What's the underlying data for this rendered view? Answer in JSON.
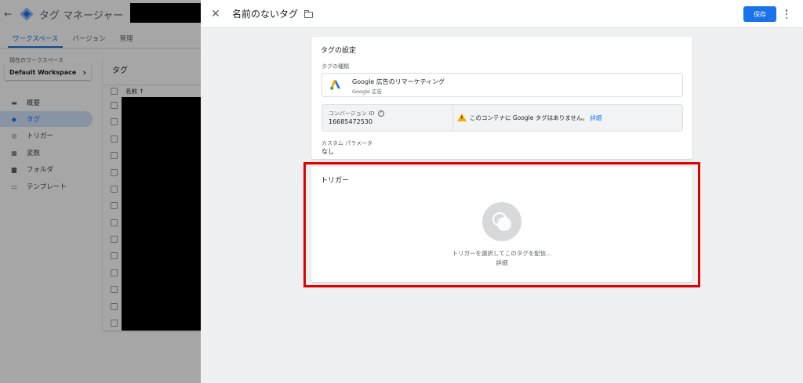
{
  "app": {
    "back_glyph": "←",
    "title": "タグ マネージャー"
  },
  "subnav": {
    "tabs": [
      "ワークスペース",
      "バージョン",
      "管理"
    ]
  },
  "workspace": {
    "label": "現在のワークスペース",
    "name": "Default Workspace",
    "chevron": "›"
  },
  "sidebar": {
    "items": [
      {
        "label": "概要",
        "icon": "overview-icon",
        "glyph": "▬"
      },
      {
        "label": "タグ",
        "icon": "tag-icon",
        "glyph": "◆"
      },
      {
        "label": "トリガー",
        "icon": "trigger-icon",
        "glyph": "◎"
      },
      {
        "label": "変数",
        "icon": "variables-icon",
        "glyph": "▦"
      },
      {
        "label": "フォルダ",
        "icon": "folder-icon",
        "glyph": "▆"
      },
      {
        "label": "テンプレート",
        "icon": "template-icon",
        "glyph": "▭"
      }
    ]
  },
  "tag_list": {
    "title": "タグ",
    "col_name": "名前 ↑"
  },
  "panel": {
    "close_glyph": "✕",
    "title": "名前のないタグ",
    "save_label": "保存",
    "config": {
      "title": "タグの設定",
      "type_label": "タグの種類",
      "type_name": "Google 広告のリマーケティング",
      "type_sub": "Google 広告",
      "conversion_label": "コンバージョン ID",
      "help_glyph": "?",
      "conversion_value": "16685472530",
      "warning_text": "このコンテナに Google タグはありません。",
      "warning_link": "詳細",
      "custom_params_label": "カスタム パラメータ",
      "custom_params_value": "なし"
    },
    "trigger": {
      "title": "トリガー",
      "empty_text": "トリガーを選択してこのタグを配信...",
      "link": "詳細"
    }
  },
  "colors": {
    "accent": "#1a73e8",
    "warning": "#f9ab00",
    "highlight": "#e00000"
  }
}
